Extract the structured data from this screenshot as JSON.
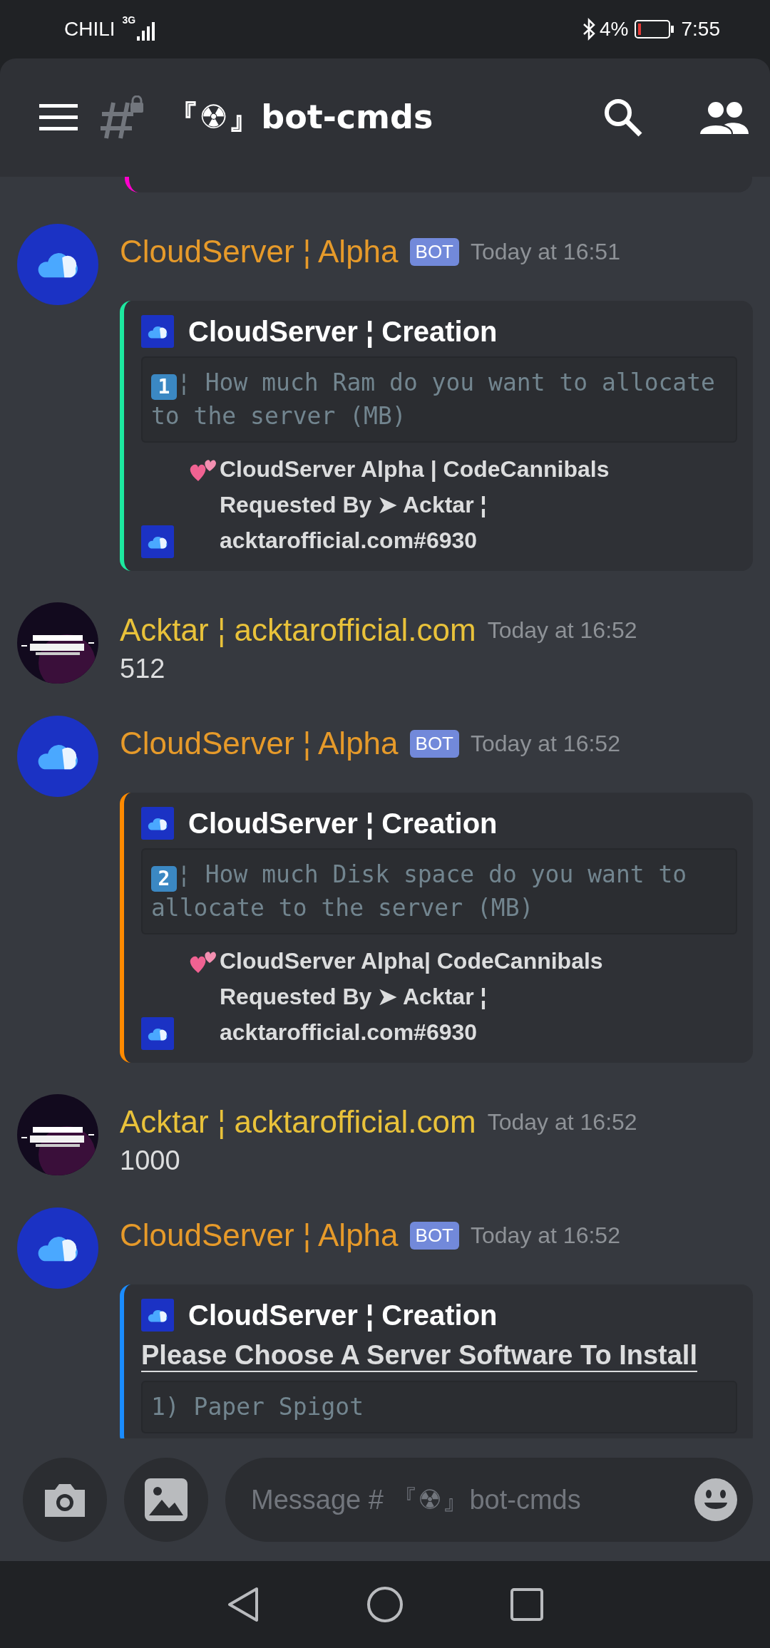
{
  "status_bar": {
    "carrier": "CHILI",
    "network": "3G",
    "battery": "4%",
    "time": "7:55"
  },
  "header": {
    "channel": "『☢』bot-cmds"
  },
  "top_embed": {
    "color": "#ff00cc"
  },
  "messages": [
    {
      "kind": "embed",
      "author": "CloudServer ¦ Alpha",
      "color": "#e69a2a",
      "bot_tag": "BOT",
      "timestamp": "Today at 16:51",
      "embed": {
        "color": "#1de9a0",
        "title": "CloudServer ¦ Creation",
        "code_keycap": "1",
        "code": "¦ How much Ram do you want to allocate to the server (MB)",
        "footer": "CloudServer Alpha | CodeCannibals\nRequested By ➤ Acktar ¦\nacktarofficial.com#6930"
      }
    },
    {
      "kind": "text",
      "author": "Acktar ¦ acktarofficial.com",
      "color": "#e9c23a",
      "timestamp": "Today at 16:52",
      "text": "512"
    },
    {
      "kind": "embed",
      "author": "CloudServer ¦ Alpha",
      "color": "#e69a2a",
      "bot_tag": "BOT",
      "timestamp": "Today at 16:52",
      "embed": {
        "color": "#ff8a00",
        "title": "CloudServer ¦ Creation",
        "code_keycap": "2",
        "code": "¦ How much Disk space do you want to allocate to the server (MB)",
        "footer": "CloudServer Alpha| CodeCannibals\nRequested By ➤ Acktar ¦\nacktarofficial.com#6930"
      }
    },
    {
      "kind": "text",
      "author": "Acktar ¦ acktarofficial.com",
      "color": "#e9c23a",
      "timestamp": "Today at 16:52",
      "text": "1000"
    },
    {
      "kind": "embed",
      "author": "CloudServer ¦ Alpha",
      "color": "#e69a2a",
      "bot_tag": "BOT",
      "timestamp": "Today at 16:52",
      "embed": {
        "color": "#1a8cff",
        "title": "CloudServer ¦ Creation",
        "heading": "Please Choose A Server Software To Install",
        "code": "1) Paper Spigot"
      }
    }
  ],
  "composer": {
    "placeholder": "Message # 『☢』bot-cmds"
  }
}
